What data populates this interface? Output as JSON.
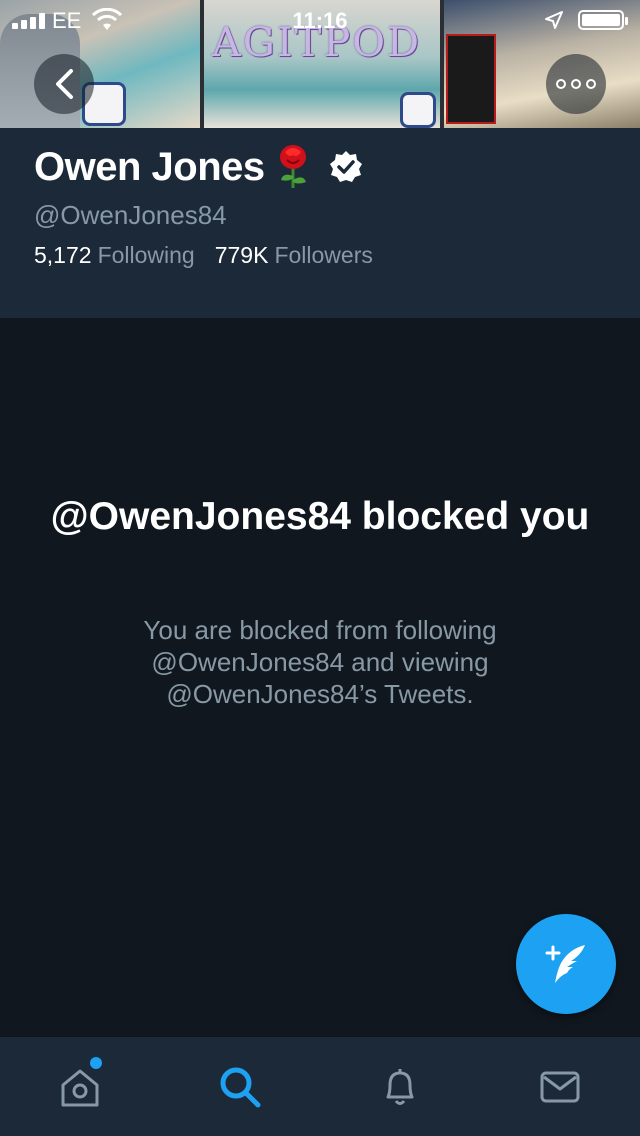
{
  "status_bar": {
    "carrier": "EE",
    "time": "11:16"
  },
  "banner": {
    "overlay_text": "AGITPOD"
  },
  "profile": {
    "name": "Owen Jones",
    "handle": "@OwenJones84",
    "verified": true,
    "following_count": "5,172",
    "following_label": "Following",
    "followers_count": "779K",
    "followers_label": "Followers"
  },
  "blocked": {
    "title": "@OwenJones84 blocked you",
    "description": "You are blocked from following @OwenJones84 and viewing @OwenJones84’s Tweets."
  },
  "tabs": [
    {
      "icon": "home-icon",
      "has_notification_dot": true
    },
    {
      "icon": "search-icon",
      "active": true
    },
    {
      "icon": "bell-icon"
    },
    {
      "icon": "mail-icon"
    }
  ],
  "colors": {
    "accent": "#1da1f2",
    "header_bg": "#1c2938",
    "main_bg": "#10171e",
    "muted_text": "#8899a6"
  }
}
